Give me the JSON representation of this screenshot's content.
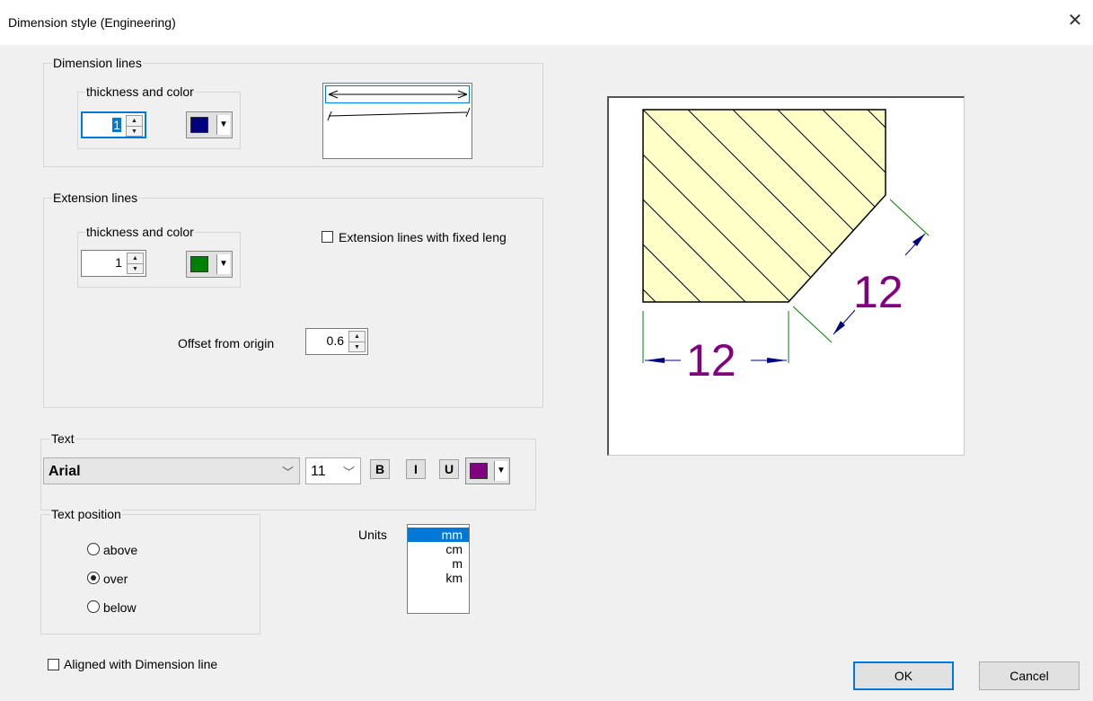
{
  "window": {
    "title": "Dimension style (Engineering)",
    "close_glyph": "✕"
  },
  "dimension_lines": {
    "group_label": "Dimension lines",
    "sub_label": "thickness and color",
    "thickness": "1",
    "color": "#000080"
  },
  "extension_lines": {
    "group_label": "Extension lines",
    "sub_label": "thickness and color",
    "thickness": "1",
    "color": "#008000",
    "fixed_length_label": "Extension lines with fixed leng",
    "fixed_length_checked": false,
    "offset_label": "Offset from origin",
    "offset_value": "0.6"
  },
  "text": {
    "group_label": "Text",
    "font": "Arial",
    "size": "11",
    "bold": "B",
    "italic": "I",
    "underline": "U",
    "color": "#800080"
  },
  "text_position": {
    "group_label": "Text position",
    "options": [
      "above",
      "over",
      "below"
    ],
    "selected": "over"
  },
  "units": {
    "label": "Units",
    "options": [
      "mm",
      "cm",
      "m",
      "km"
    ],
    "selected": "mm"
  },
  "aligned_label": "Aligned with Dimension line",
  "preview": {
    "dim_text_1": "12",
    "dim_text_2": "12"
  },
  "buttons": {
    "ok": "OK",
    "cancel": "Cancel"
  }
}
